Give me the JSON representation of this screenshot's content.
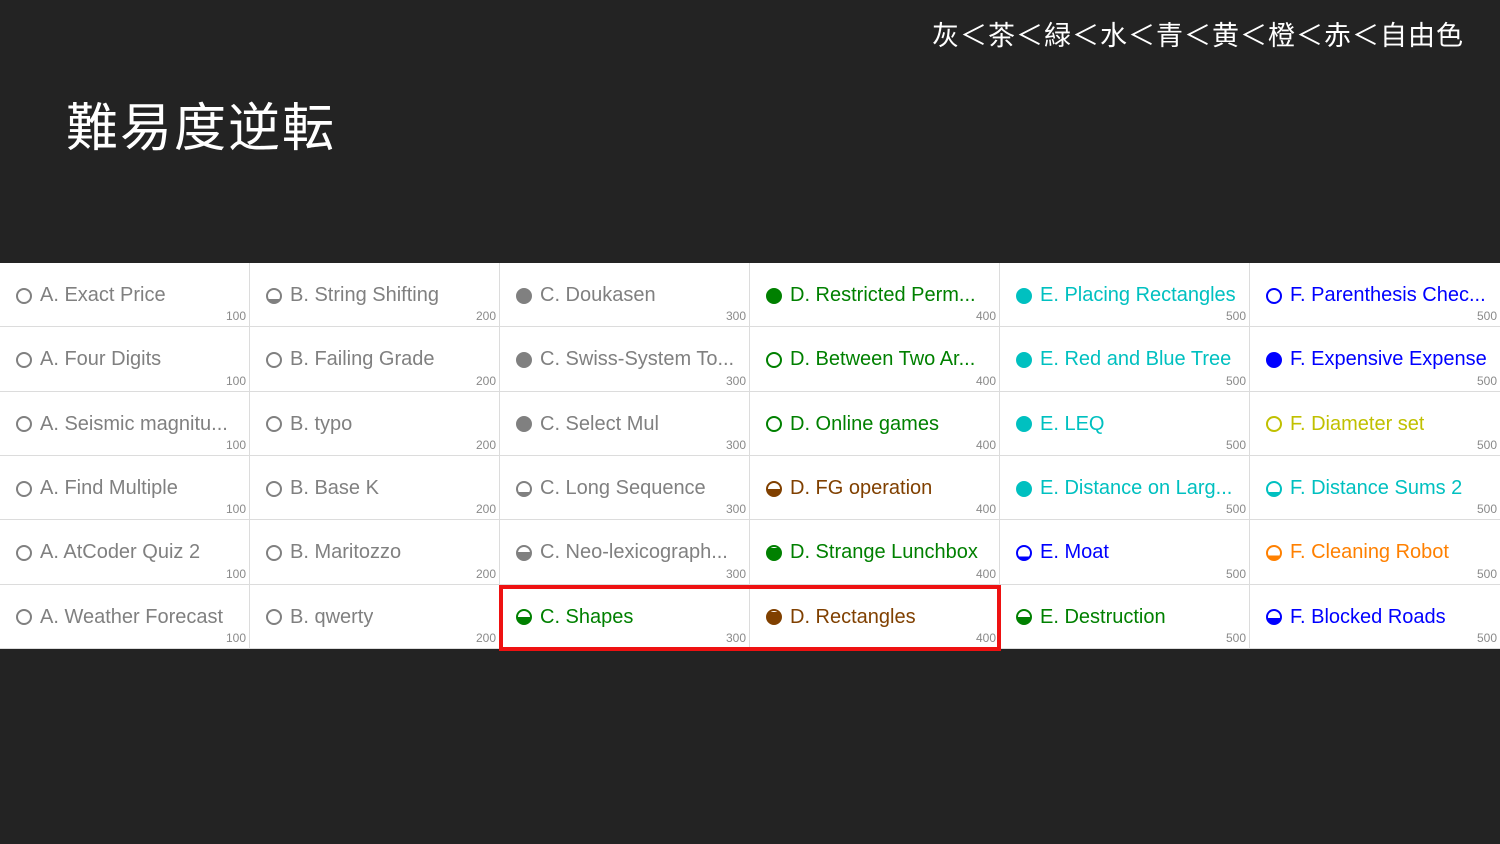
{
  "legend_text": "灰＜茶＜緑＜水＜青＜黄＜橙＜赤＜自由色",
  "title": "難易度逆転",
  "colors": {
    "gray": "#808080",
    "brown": "#804000",
    "green": "#008000",
    "cyan": "#00c0c0",
    "blue": "#0000ff",
    "yellow": "#c0c000",
    "orange": "#ff8000"
  },
  "grid": {
    "rows": [
      [
        {
          "name": "A. Exact Price",
          "points": "100",
          "color": "#808080",
          "fill": 0
        },
        {
          "name": "B. String Shifting",
          "points": "200",
          "color": "#808080",
          "fill": 0.25
        },
        {
          "name": "C. Doukasen",
          "points": "300",
          "color": "#808080",
          "fill": 1
        },
        {
          "name": "D. Restricted Perm...",
          "points": "400",
          "color": "#008000",
          "fill": 1
        },
        {
          "name": "E. Placing Rectangles",
          "points": "500",
          "color": "#00c0c0",
          "fill": 1
        },
        {
          "name": "F. Parenthesis Chec...",
          "points": "500",
          "color": "#0000ff",
          "fill": 0
        }
      ],
      [
        {
          "name": "A. Four Digits",
          "points": "100",
          "color": "#808080",
          "fill": 0
        },
        {
          "name": "B. Failing Grade",
          "points": "200",
          "color": "#808080",
          "fill": 0
        },
        {
          "name": "C. Swiss-System To...",
          "points": "300",
          "color": "#808080",
          "fill": 1
        },
        {
          "name": "D. Between Two Ar...",
          "points": "400",
          "color": "#008000",
          "fill": 0
        },
        {
          "name": "E. Red and Blue Tree",
          "points": "500",
          "color": "#00c0c0",
          "fill": 1
        },
        {
          "name": "F. Expensive Expense",
          "points": "500",
          "color": "#0000ff",
          "fill": 1
        }
      ],
      [
        {
          "name": "A. Seismic magnitu...",
          "points": "100",
          "color": "#808080",
          "fill": 0
        },
        {
          "name": "B. typo",
          "points": "200",
          "color": "#808080",
          "fill": 0
        },
        {
          "name": "C. Select Mul",
          "points": "300",
          "color": "#808080",
          "fill": 1
        },
        {
          "name": "D. Online games",
          "points": "400",
          "color": "#008000",
          "fill": 0
        },
        {
          "name": "E. LEQ",
          "points": "500",
          "color": "#00c0c0",
          "fill": 1
        },
        {
          "name": "F. Diameter set",
          "points": "500",
          "color": "#c0c000",
          "fill": 0
        }
      ],
      [
        {
          "name": "A. Find Multiple",
          "points": "100",
          "color": "#808080",
          "fill": 0
        },
        {
          "name": "B. Base K",
          "points": "200",
          "color": "#808080",
          "fill": 0
        },
        {
          "name": "C. Long Sequence",
          "points": "300",
          "color": "#808080",
          "fill": 0.25
        },
        {
          "name": "D. FG operation",
          "points": "400",
          "color": "#804000",
          "fill": 0.5
        },
        {
          "name": "E. Distance on Larg...",
          "points": "500",
          "color": "#00c0c0",
          "fill": 1
        },
        {
          "name": "F. Distance Sums 2",
          "points": "500",
          "color": "#00c0c0",
          "fill": 0.25
        }
      ],
      [
        {
          "name": "A. AtCoder Quiz 2",
          "points": "100",
          "color": "#808080",
          "fill": 0
        },
        {
          "name": "B. Maritozzo",
          "points": "200",
          "color": "#808080",
          "fill": 0
        },
        {
          "name": "C. Neo-lexicograph...",
          "points": "300",
          "color": "#808080",
          "fill": 0.6
        },
        {
          "name": "D. Strange Lunchbox",
          "points": "400",
          "color": "#008000",
          "fill": 0.9
        },
        {
          "name": "E. Moat",
          "points": "500",
          "color": "#0000ff",
          "fill": 0.2
        },
        {
          "name": "F. Cleaning Robot",
          "points": "500",
          "color": "#ff8000",
          "fill": 0.3
        }
      ],
      [
        {
          "name": "A. Weather Forecast",
          "points": "100",
          "color": "#808080",
          "fill": 0
        },
        {
          "name": "B. qwerty",
          "points": "200",
          "color": "#808080",
          "fill": 0
        },
        {
          "name": "C. Shapes",
          "points": "300",
          "color": "#008000",
          "fill": 0.5
        },
        {
          "name": "D. Rectangles",
          "points": "400",
          "color": "#804000",
          "fill": 0.9
        },
        {
          "name": "E. Destruction",
          "points": "500",
          "color": "#008000",
          "fill": 0.5
        },
        {
          "name": "F. Blocked Roads",
          "points": "500",
          "color": "#0000ff",
          "fill": 0.4
        }
      ]
    ]
  }
}
